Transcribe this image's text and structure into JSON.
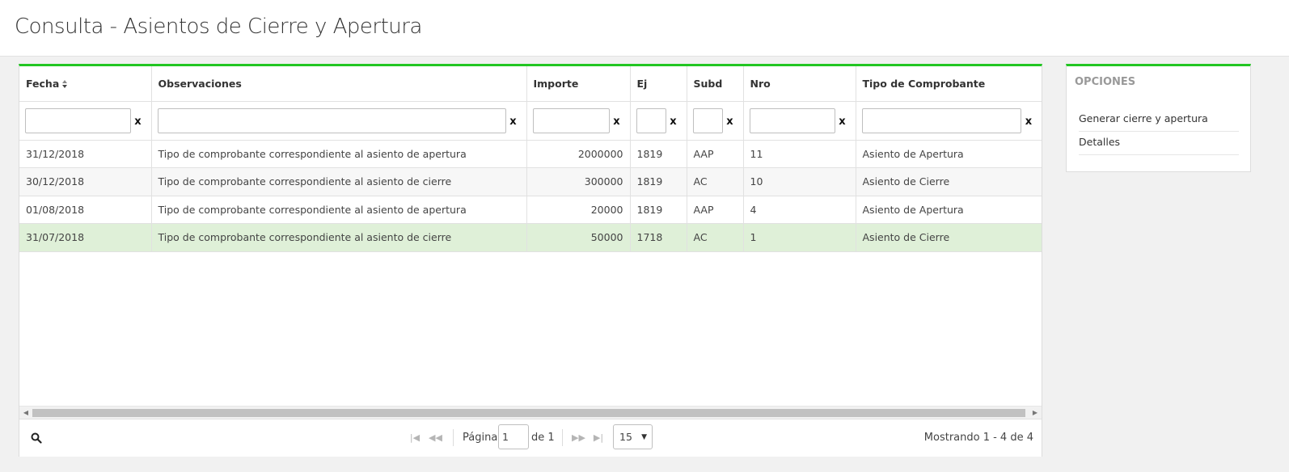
{
  "page": {
    "title": "Consulta - Asientos de Cierre y Apertura"
  },
  "grid": {
    "columns": [
      {
        "label": "Fecha",
        "sorted": "asc"
      },
      {
        "label": "Observaciones"
      },
      {
        "label": "Importe"
      },
      {
        "label": "Ej"
      },
      {
        "label": "Subd"
      },
      {
        "label": "Nro"
      },
      {
        "label": "Tipo de Comprobante"
      }
    ],
    "filter_clear_label": "x",
    "rows": [
      {
        "fecha": "31/12/2018",
        "observaciones": "Tipo de comprobante correspondiente al asiento de apertura",
        "importe": "2000000",
        "ej": "1819",
        "subd": "AAP",
        "nro": "11",
        "tipo": "Asiento de Apertura"
      },
      {
        "fecha": "30/12/2018",
        "observaciones": "Tipo de comprobante correspondiente al asiento de cierre",
        "importe": "300000",
        "ej": "1819",
        "subd": "AC",
        "nro": "10",
        "tipo": "Asiento de Cierre"
      },
      {
        "fecha": "01/08/2018",
        "observaciones": "Tipo de comprobante correspondiente al asiento de apertura",
        "importe": "20000",
        "ej": "1819",
        "subd": "AAP",
        "nro": "4",
        "tipo": "Asiento de Apertura"
      },
      {
        "fecha": "31/07/2018",
        "observaciones": "Tipo de comprobante correspondiente al asiento de cierre",
        "importe": "50000",
        "ej": "1718",
        "subd": "AC",
        "nro": "1",
        "tipo": "Asiento de Cierre",
        "selected": true
      }
    ],
    "selected_row_color": "#dff0d8",
    "accent_color": "#22c622"
  },
  "pager": {
    "page_label": "Página",
    "page_value": "1",
    "of_label": "de 1",
    "page_size": "15",
    "showing": "Mostrando 1 - 4 de 4"
  },
  "options": {
    "title": "OPCIONES",
    "items": [
      {
        "label": "Generar cierre y apertura"
      },
      {
        "label": "Detalles"
      }
    ]
  }
}
